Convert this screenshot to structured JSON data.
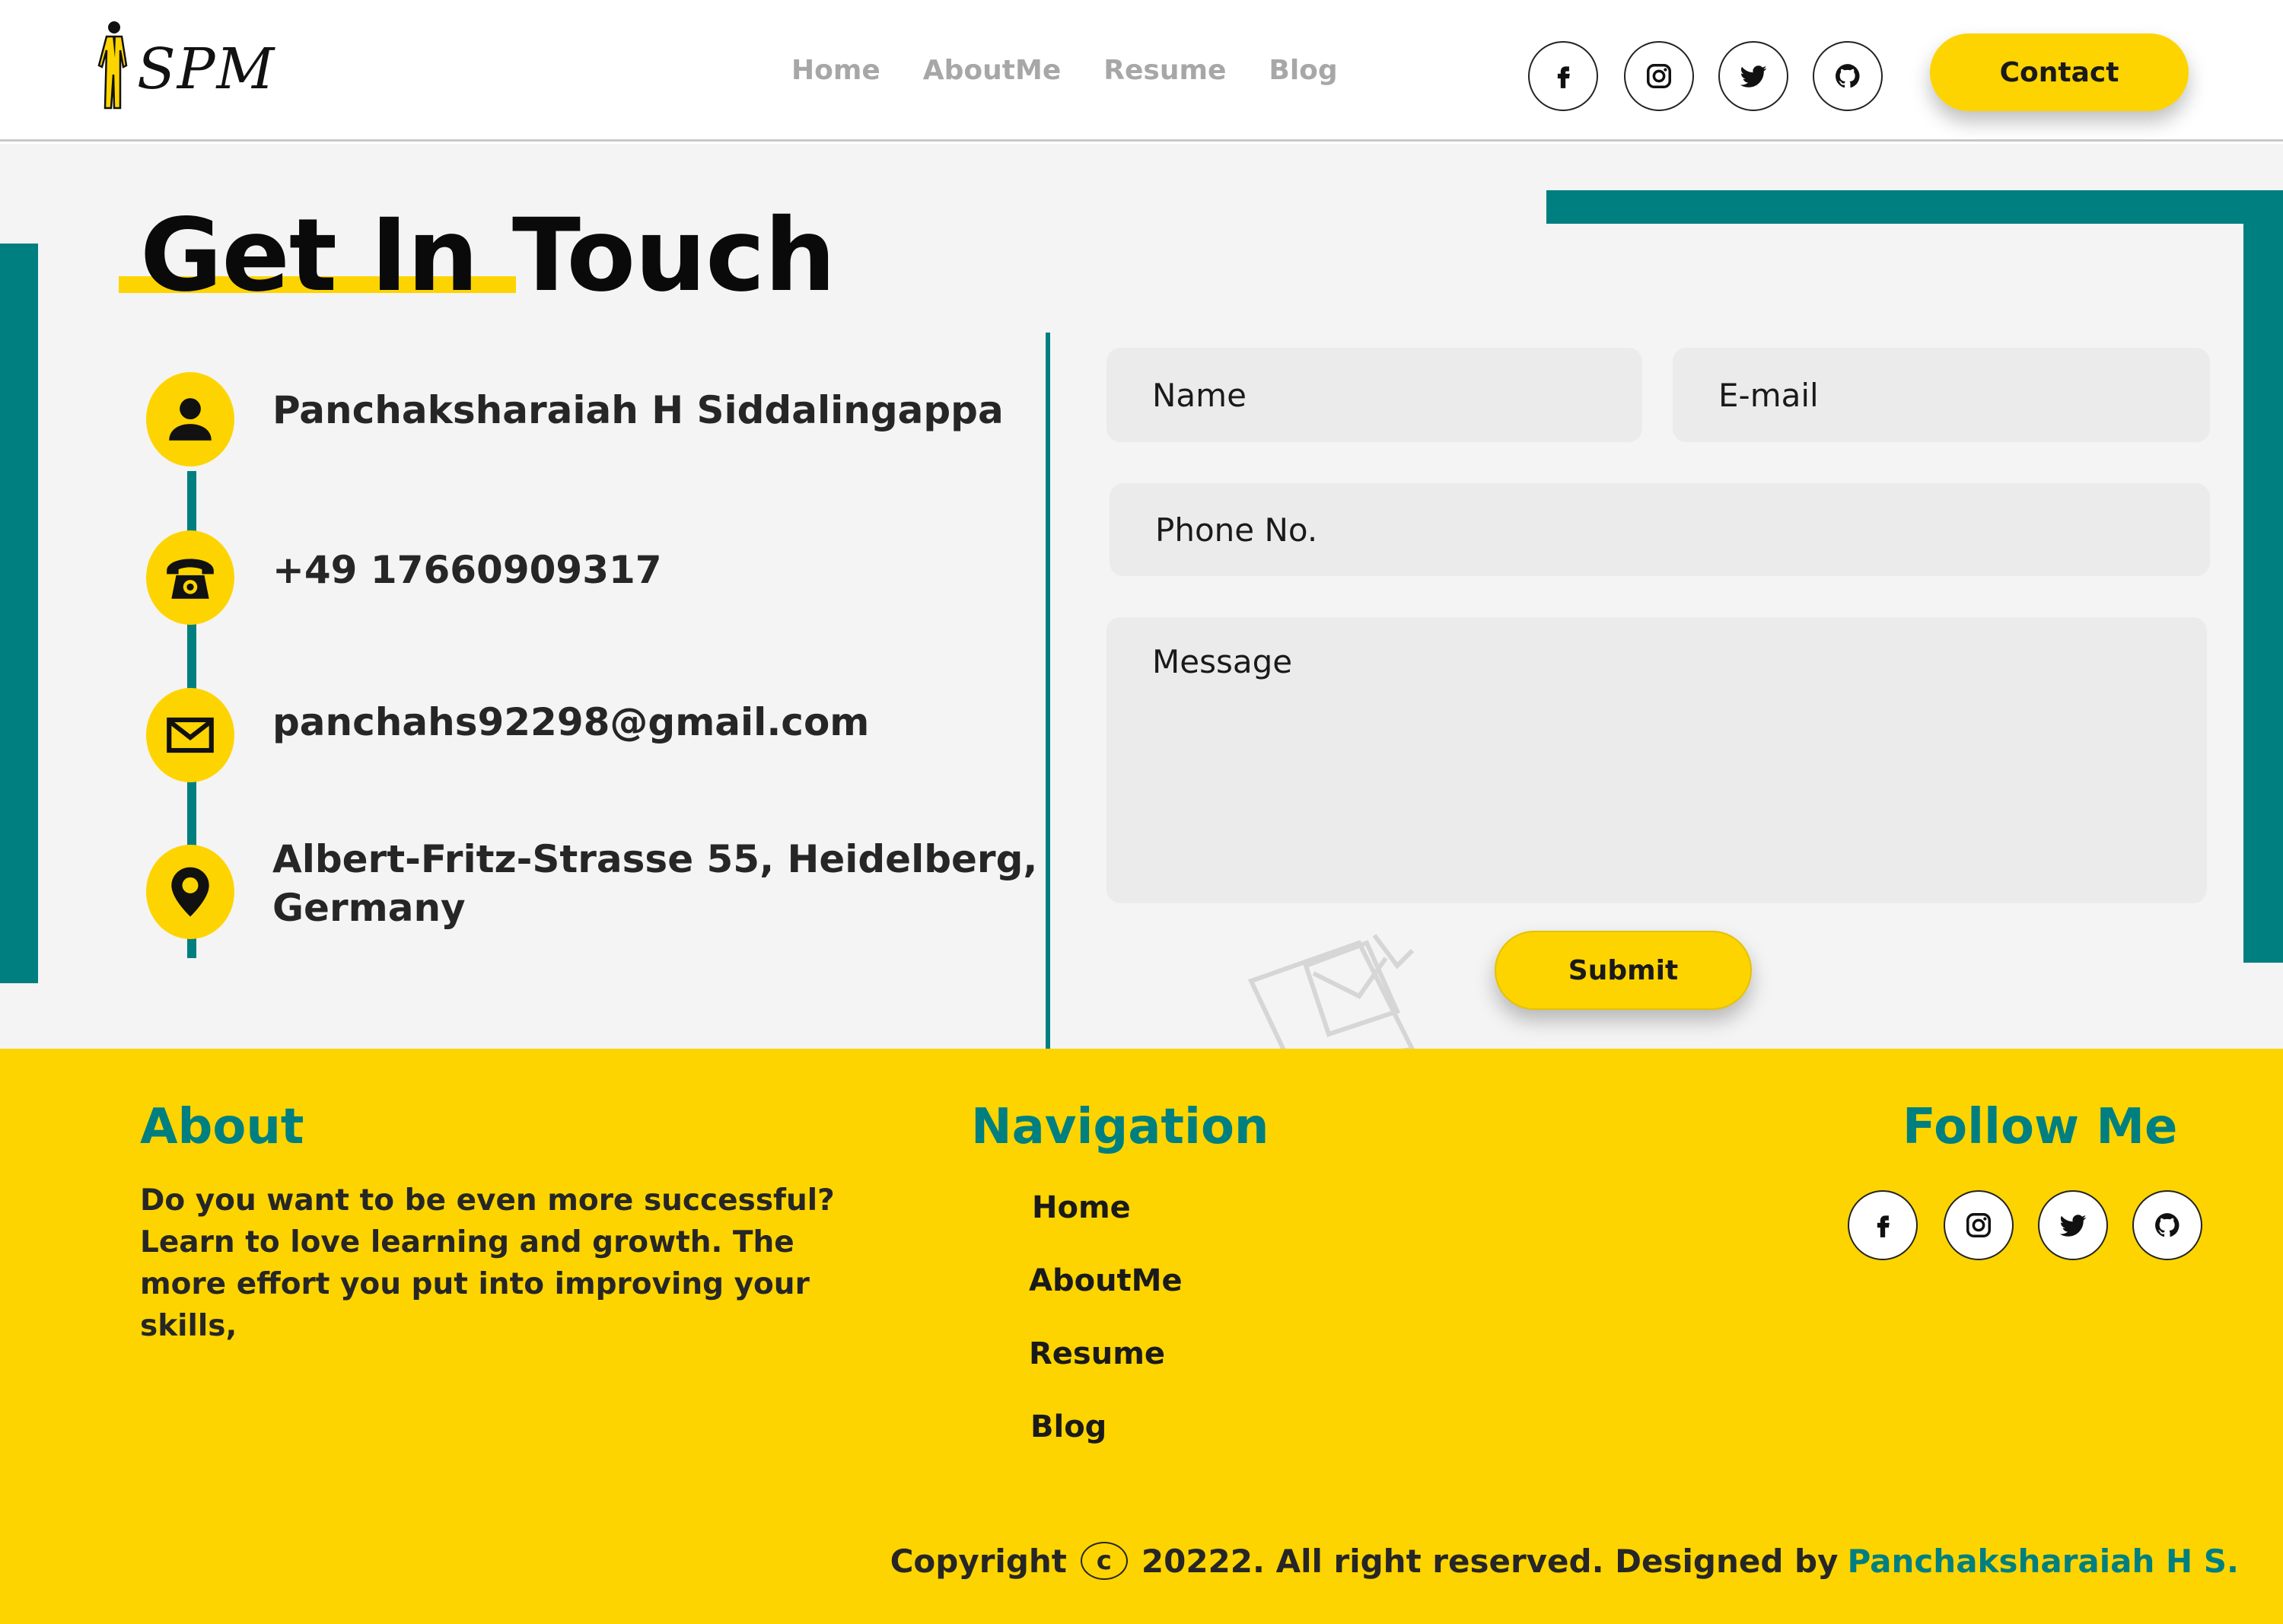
{
  "header": {
    "logo_text": "SPM",
    "nav": [
      "Home",
      "AboutMe",
      "Resume",
      "Blog"
    ],
    "social_icons": [
      "facebook-icon",
      "instagram-icon",
      "twitter-icon",
      "github-icon"
    ],
    "contact_label": "Contact"
  },
  "contact": {
    "title": "Get In Touch",
    "name": "Panchaksharaiah H Siddalingappa",
    "phone": "+49 17660909317",
    "email": "panchahs92298@gmail.com",
    "address_line1": "Albert-Fritz-Strasse 55, Heidelberg,",
    "address_line2": "Germany",
    "form": {
      "name_placeholder": "Name",
      "email_placeholder": "E-mail",
      "phone_placeholder": "Phone No.",
      "message_placeholder": "Message",
      "submit_label": "Submit"
    }
  },
  "footer": {
    "about_title": "About",
    "about_text": "Do you want to be even more successful? Learn to love learning and growth. The more effort you put into improving your skills,",
    "nav_title": "Navigation",
    "nav_links": [
      "Home",
      "AboutMe",
      "Resume",
      "Blog"
    ],
    "follow_title": "Follow Me",
    "copyright_prefix": "Copyright",
    "copyright_symbol": "c",
    "copyright_text": "20222. All right reserved. Designed by",
    "designer": "Panchaksharaiah H S."
  },
  "colors": {
    "accent_yellow": "#fdd400",
    "accent_teal": "#007f80",
    "nav_gray": "#a7a7a7"
  }
}
